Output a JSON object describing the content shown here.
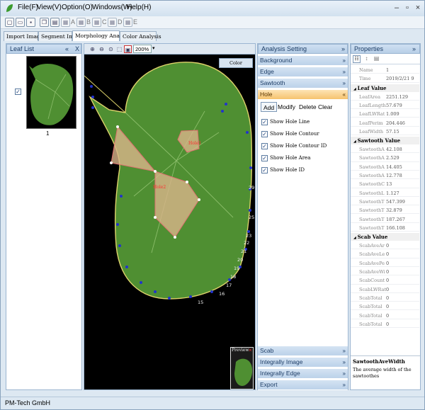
{
  "menu": [
    "File(F)",
    "View(V)",
    "Option(O)",
    "Windows(W)",
    "Help(H)"
  ],
  "window_controls": [
    "minimize-icon",
    "restore-icon",
    "close-icon"
  ],
  "toolbar": {
    "labels": [
      "A",
      "B",
      "C",
      "D",
      "E"
    ]
  },
  "tabs": [
    "Import Image",
    "Segment Image",
    "Morphology Analysis",
    "Color Analysis"
  ],
  "active_tab": "Morphology Analysis",
  "leaf_list": {
    "title": "Leaf List",
    "pin": "«",
    "close": "X",
    "items": [
      {
        "label": "1",
        "checked": true
      }
    ]
  },
  "viewer": {
    "zoom": "200%",
    "color_analysis_label": "Color Analysis",
    "preview_label": "Preview",
    "hole_labels": [
      "Hole1",
      "Hole2"
    ],
    "edge_numbers": [
      "29",
      "25",
      "23",
      "22",
      "21",
      "20",
      "19",
      "18",
      "17",
      "16",
      "15"
    ]
  },
  "analysis": {
    "title": "Analysis Setting",
    "sections_top": [
      "Background",
      "Edge",
      "Sawtooth"
    ],
    "active_section": "Hole",
    "hole_buttons": [
      "Add",
      "Modify",
      "Delete",
      "Clear"
    ],
    "options": [
      {
        "label": "Show Hole Line",
        "checked": true
      },
      {
        "label": "Show Hole Contour",
        "checked": true
      },
      {
        "label": "Show Hole Contour ID",
        "checked": true
      },
      {
        "label": "Show Hole Area",
        "checked": true
      },
      {
        "label": "Show Hole ID",
        "checked": true
      }
    ],
    "sections_bottom": [
      "Scab",
      "Integrally Image",
      "Integrally Edge",
      "Export"
    ]
  },
  "properties": {
    "title": "Properties",
    "rows_top": [
      {
        "name": "Name",
        "value": "1"
      },
      {
        "name": "Time",
        "value": "2019/2/21 9"
      }
    ],
    "categories": [
      {
        "name": "Leaf Value",
        "rows": [
          {
            "name": "LeafArea",
            "value": "2251.129"
          },
          {
            "name": "LeafLength",
            "value": "57.679"
          },
          {
            "name": "LeafLWRat",
            "value": "1.009"
          },
          {
            "name": "LeafPerim",
            "value": "204.446"
          },
          {
            "name": "LeafWidth",
            "value": "57.15"
          }
        ]
      },
      {
        "name": "Sawtooth Value",
        "rows": [
          {
            "name": "SawtoothA",
            "value": "42.108"
          },
          {
            "name": "SawtoothA",
            "value": "2.529"
          },
          {
            "name": "SawtoothA",
            "value": "14.405"
          },
          {
            "name": "SawtoothA",
            "value": "12.778"
          },
          {
            "name": "SawtoothC",
            "value": "13"
          },
          {
            "name": "SawtoothL",
            "value": "1.127"
          },
          {
            "name": "SawtoothT",
            "value": "547.399"
          },
          {
            "name": "SawtoothT",
            "value": "32.879"
          },
          {
            "name": "SawtoothT",
            "value": "187.267"
          },
          {
            "name": "SawtoothT",
            "value": "166.108"
          }
        ]
      },
      {
        "name": "Scab Value",
        "rows": [
          {
            "name": "ScabAveAr",
            "value": "0"
          },
          {
            "name": "ScabAveLe",
            "value": "0"
          },
          {
            "name": "ScabAvePe",
            "value": "0"
          },
          {
            "name": "ScabAveWi",
            "value": "0"
          },
          {
            "name": "ScabCount",
            "value": "0"
          },
          {
            "name": "ScabLWRat",
            "value": "0"
          },
          {
            "name": "ScabTotal",
            "value": "0"
          },
          {
            "name": "ScabTotal",
            "value": "0"
          },
          {
            "name": "ScabTotal",
            "value": "0"
          },
          {
            "name": "ScabTotal",
            "value": "0"
          }
        ]
      }
    ],
    "desc_title": "SawtoothAveWidth",
    "desc_text": "The average width of the sawtoothes"
  },
  "status": "PM-Tech GmbH",
  "colors": {
    "leaf": "#4f8f32",
    "hole_fill": "#d9b48a",
    "hole_line": "#e07070",
    "edge_dots": "#2233cc",
    "accent": "#f6c36e"
  }
}
